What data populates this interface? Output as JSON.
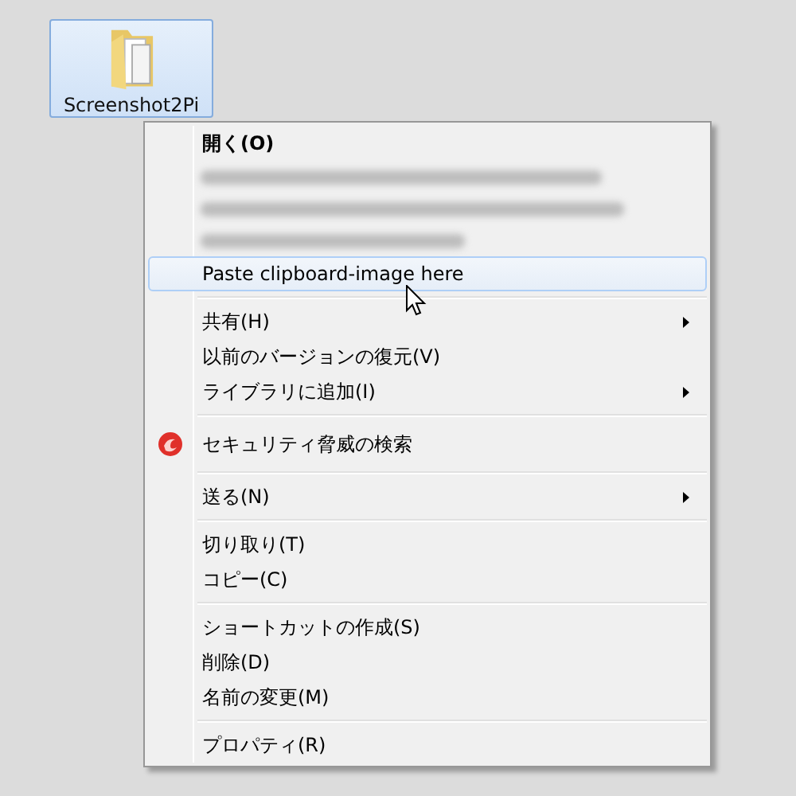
{
  "desktop_icon": {
    "label": "Screenshot2Pi",
    "selected": true
  },
  "context_menu": {
    "items": [
      {
        "kind": "item",
        "label": "開く(O)",
        "default": true,
        "selected": false,
        "submenu": false,
        "has_icon": false
      },
      {
        "kind": "blurred"
      },
      {
        "kind": "blurred"
      },
      {
        "kind": "blurred"
      },
      {
        "kind": "item",
        "label": "Paste clipboard-image here",
        "default": false,
        "selected": true,
        "submenu": false,
        "has_icon": false
      },
      {
        "kind": "separator"
      },
      {
        "kind": "item",
        "label": "共有(H)",
        "default": false,
        "selected": false,
        "submenu": true,
        "has_icon": false
      },
      {
        "kind": "item",
        "label": "以前のバージョンの復元(V)",
        "default": false,
        "selected": false,
        "submenu": false,
        "has_icon": false
      },
      {
        "kind": "item",
        "label": "ライブラリに追加(I)",
        "default": false,
        "selected": false,
        "submenu": true,
        "has_icon": false
      },
      {
        "kind": "separator"
      },
      {
        "kind": "item",
        "label": "セキュリティ脅威の検索",
        "default": false,
        "selected": false,
        "submenu": false,
        "has_icon": true
      },
      {
        "kind": "separator"
      },
      {
        "kind": "item",
        "label": "送る(N)",
        "default": false,
        "selected": false,
        "submenu": true,
        "has_icon": false
      },
      {
        "kind": "separator"
      },
      {
        "kind": "item",
        "label": "切り取り(T)",
        "default": false,
        "selected": false,
        "submenu": false,
        "has_icon": false
      },
      {
        "kind": "item",
        "label": "コピー(C)",
        "default": false,
        "selected": false,
        "submenu": false,
        "has_icon": false
      },
      {
        "kind": "separator"
      },
      {
        "kind": "item",
        "label": "ショートカットの作成(S)",
        "default": false,
        "selected": false,
        "submenu": false,
        "has_icon": false
      },
      {
        "kind": "item",
        "label": "削除(D)",
        "default": false,
        "selected": false,
        "submenu": false,
        "has_icon": false
      },
      {
        "kind": "item",
        "label": "名前の変更(M)",
        "default": false,
        "selected": false,
        "submenu": false,
        "has_icon": false
      },
      {
        "kind": "separator"
      },
      {
        "kind": "item",
        "label": "プロパティ(R)",
        "default": false,
        "selected": false,
        "submenu": false,
        "has_icon": false
      }
    ]
  }
}
